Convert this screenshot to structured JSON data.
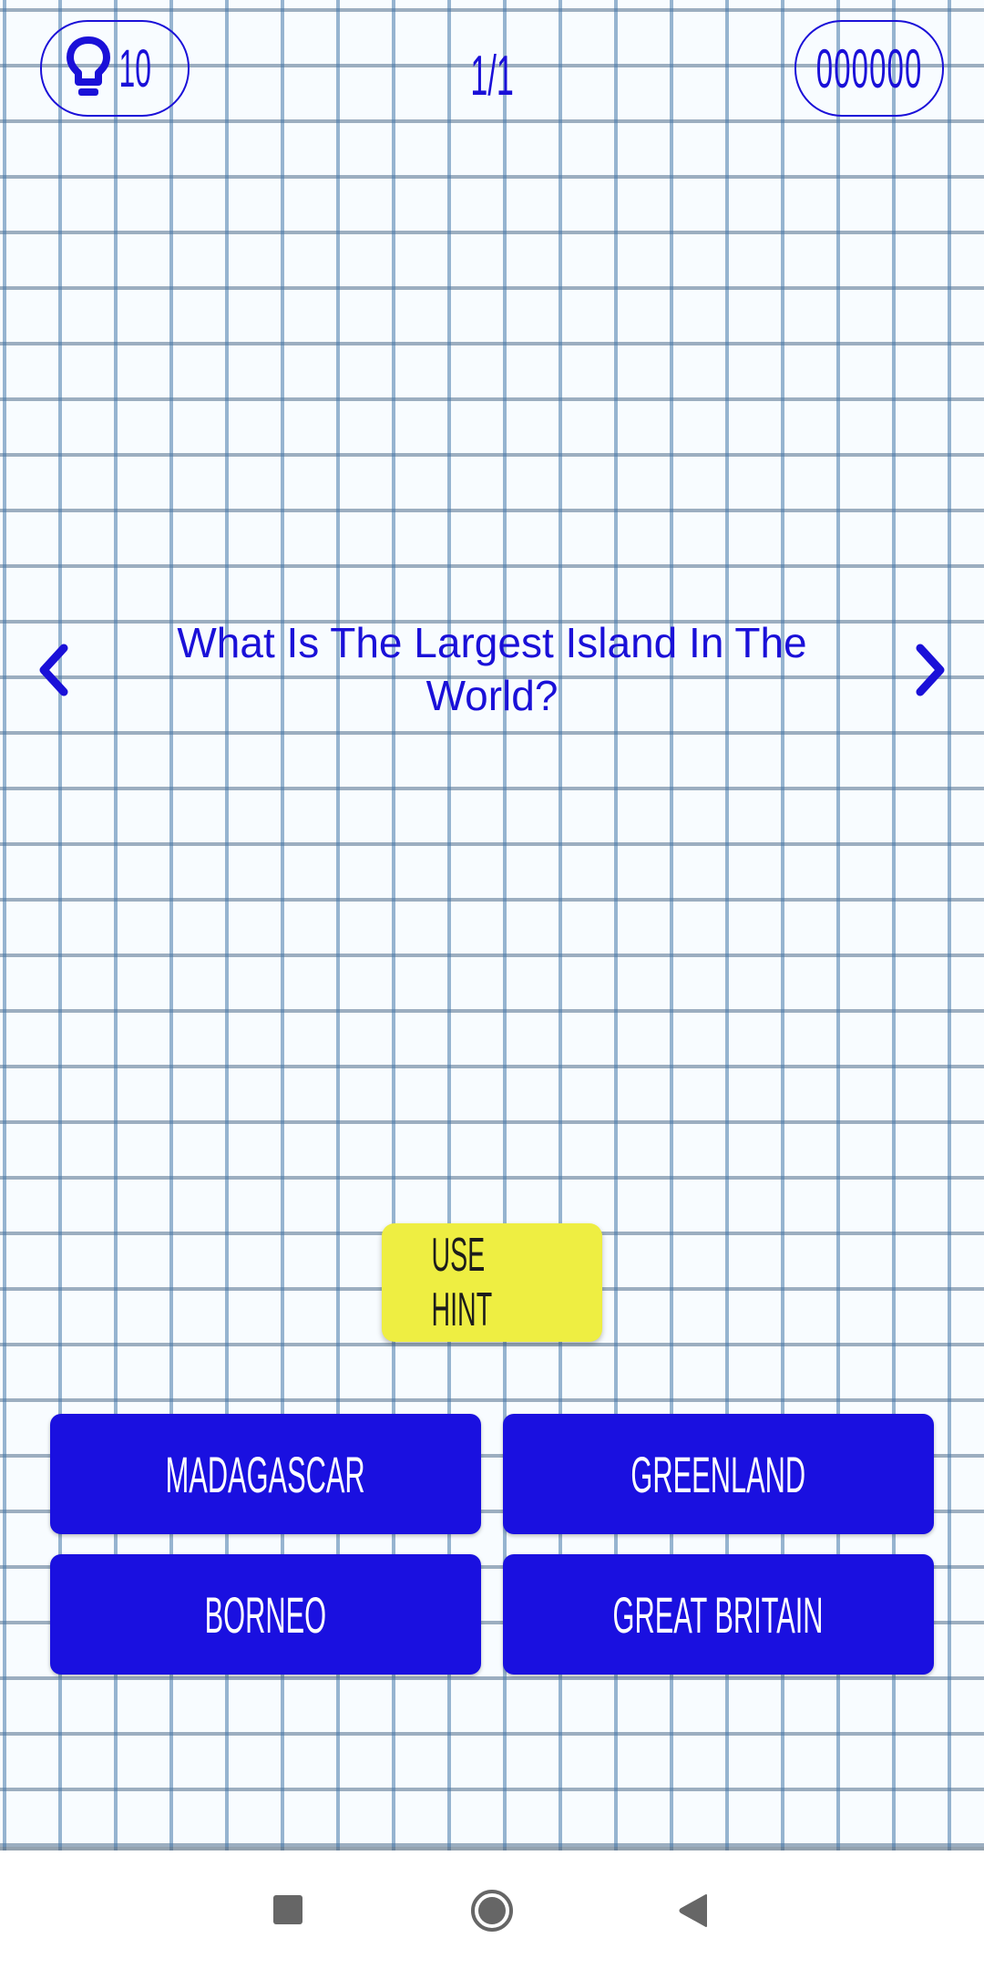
{
  "header": {
    "hints_icon": "lightbulb-icon",
    "hints_remaining": "10",
    "progress": "1/1",
    "score": "000000"
  },
  "question": {
    "text": "What Is The Largest Island In The World?",
    "prev_icon": "chevron-left-icon",
    "next_icon": "chevron-right-icon"
  },
  "hint_button": {
    "label": "USE HINT"
  },
  "answers": [
    {
      "label": "MADAGASCAR"
    },
    {
      "label": "GREENLAND"
    },
    {
      "label": "BORNEO"
    },
    {
      "label": "GREAT BRITAIN"
    }
  ],
  "colors": {
    "primary": "#1a10e0",
    "hint_button": "#eeee42",
    "grid_line": "#5a86b4"
  },
  "system_nav": {
    "recents_icon": "square-icon",
    "home_icon": "circle-icon",
    "back_icon": "triangle-back-icon"
  }
}
